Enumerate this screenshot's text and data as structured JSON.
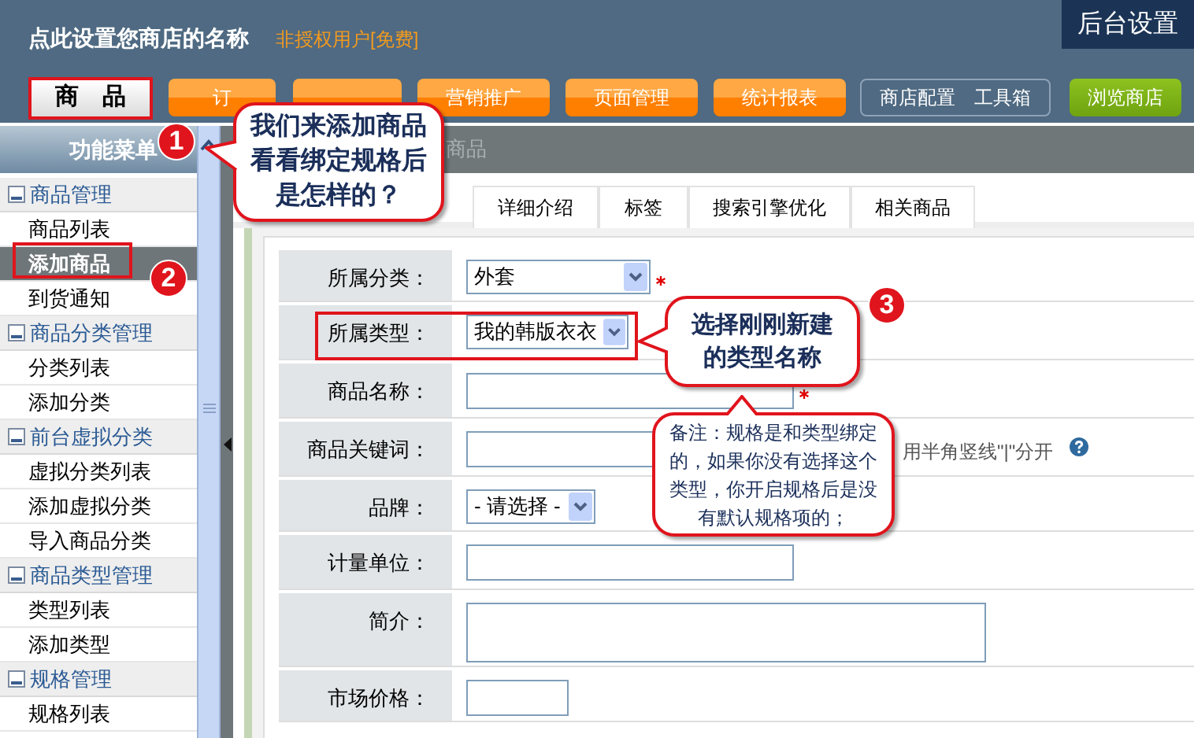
{
  "header": {
    "store_name": "点此设置您商店的名称",
    "license": "非授权用户[免费]",
    "admin_link": "后台设置"
  },
  "nav": [
    {
      "label": "商　品",
      "kind": "tab"
    },
    {
      "label": "订",
      "kind": "orange"
    },
    {
      "kind": "orange"
    },
    {
      "label": "营销推广",
      "kind": "orange"
    },
    {
      "label": "页面管理",
      "kind": "orange"
    },
    {
      "label": "统计报表",
      "kind": "orange"
    },
    {
      "label": "商店配置　工具箱",
      "kind": "outline"
    },
    {
      "label": "浏览商店",
      "kind": "green"
    }
  ],
  "sidebar": {
    "title": "功能菜单",
    "groups": [
      {
        "label": "商品管理",
        "expanded": true,
        "children": [
          {
            "label": "商品列表",
            "selected": false
          },
          {
            "label": "添加商品",
            "selected": true
          },
          {
            "label": "到货通知",
            "selected": false
          }
        ]
      },
      {
        "label": "商品分类管理",
        "expanded": true,
        "children": [
          {
            "label": "分类列表",
            "selected": false
          },
          {
            "label": "添加分类",
            "selected": false
          }
        ]
      },
      {
        "label": "前台虚拟分类",
        "expanded": true,
        "children": [
          {
            "label": "虚拟分类列表",
            "selected": false
          },
          {
            "label": "添加虚拟分类",
            "selected": false
          },
          {
            "label": "导入商品分类",
            "selected": false
          }
        ]
      },
      {
        "label": "商品类型管理",
        "expanded": true,
        "children": [
          {
            "label": "类型列表",
            "selected": false
          },
          {
            "label": "添加类型",
            "selected": false
          }
        ]
      },
      {
        "label": "规格管理",
        "expanded": true,
        "children": [
          {
            "label": "规格列表",
            "selected": false
          }
        ]
      }
    ]
  },
  "breadcrumb": "商品",
  "tabs": [
    {
      "label": "详细介绍",
      "selected": false
    },
    {
      "label": "标签",
      "selected": false
    },
    {
      "label": "搜索引擎优化",
      "selected": false
    },
    {
      "label": "相关商品",
      "selected": false
    }
  ],
  "form": [
    {
      "label": "所属分类：",
      "kind": "select",
      "value": "外套",
      "required": true
    },
    {
      "label": "所属类型：",
      "kind": "select",
      "value": "我的韩版衣衣"
    },
    {
      "label": "商品名称：",
      "kind": "input",
      "required": true
    },
    {
      "label": "商品关键词：",
      "kind": "input",
      "hint": "用半角竖线\"|\"分开",
      "help": true
    },
    {
      "label": "品牌：",
      "kind": "select",
      "value": "- 请选择 -"
    },
    {
      "label": "计量单位：",
      "kind": "input"
    },
    {
      "label": "简介：",
      "kind": "textarea"
    },
    {
      "label": "市场价格：",
      "kind": "input"
    }
  ],
  "annotations": {
    "steps": [
      "1",
      "2",
      "3"
    ],
    "callouts": [
      {
        "text": "我们来添加商品看看绑定规格后是怎样的？"
      },
      {
        "text": "选择刚刚新建的类型名称"
      },
      {
        "text": "备注：规格是和类型绑定的，如果你没有选择这个类型，你开启规格后是没有默认规格项的；"
      }
    ]
  }
}
